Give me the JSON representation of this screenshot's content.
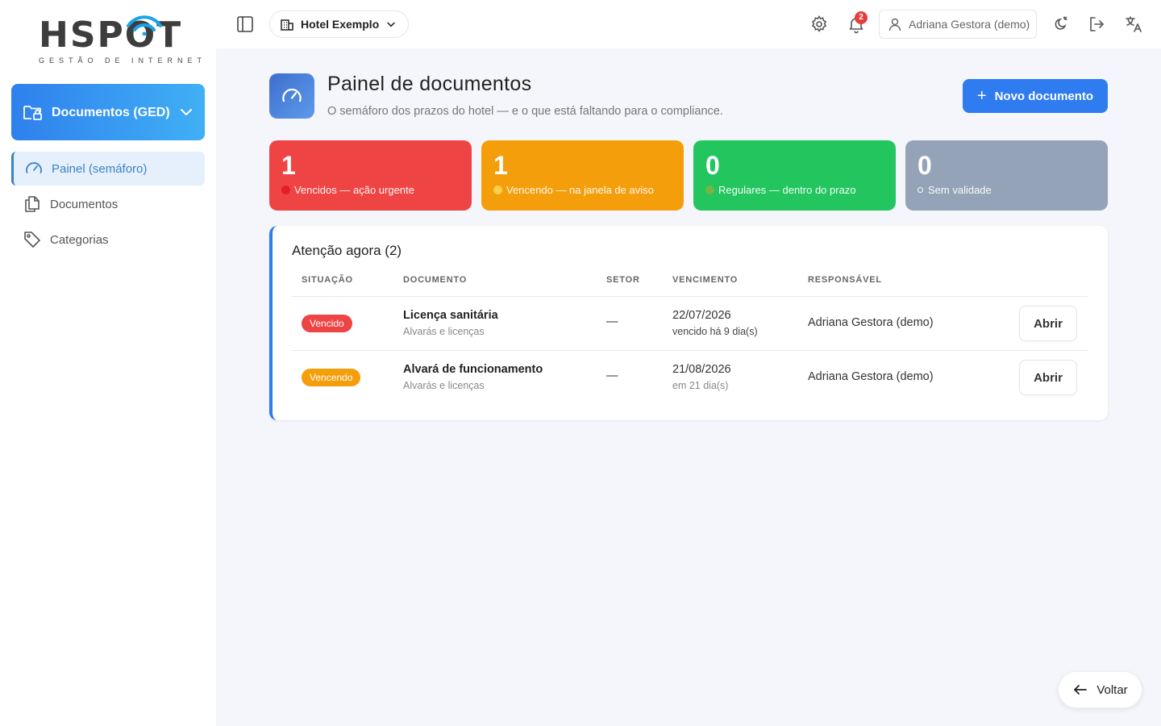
{
  "brand": {
    "name": "HSPOT",
    "tagline": "GESTÃO DE INTERNET"
  },
  "sidebar": {
    "module_label": "Documentos (GED)",
    "items": [
      {
        "label": "Painel (semáforo)",
        "icon": "gauge-icon",
        "active": true
      },
      {
        "label": "Documentos",
        "icon": "documents-icon",
        "active": false
      },
      {
        "label": "Categorias",
        "icon": "tag-icon",
        "active": false
      }
    ]
  },
  "topbar": {
    "hotel": "Hotel Exemplo",
    "notifications_count": "2",
    "user": "Adriana Gestora (demo)"
  },
  "header": {
    "title": "Painel de documentos",
    "subtitle": "O semáforo dos prazos do hotel — e o que está faltando para o compliance.",
    "new_button": "Novo documento"
  },
  "stats": [
    {
      "value": "1",
      "label": "Vencidos — ação urgente",
      "color": "#ef4444"
    },
    {
      "value": "1",
      "label": "Vencendo — na janela de aviso",
      "color": "#f59e0b"
    },
    {
      "value": "0",
      "label": "Regulares — dentro do prazo",
      "color": "#22c55e"
    },
    {
      "value": "0",
      "label": "Sem validade",
      "color": "#94a3b8"
    }
  ],
  "attention": {
    "title": "Atenção agora (2)",
    "columns": [
      "SITUAÇÃO",
      "DOCUMENTO",
      "SETOR",
      "VENCIMENTO",
      "RESPONSÁVEL"
    ],
    "rows": [
      {
        "status": "Vencido",
        "status_color": "#ef4444",
        "document": "Licença sanitária",
        "category": "Alvarás e licenças",
        "sector": "—",
        "due_date": "22/07/2026",
        "due_note": "vencido há 9 dia(s)",
        "responsible": "Adriana Gestora (demo)",
        "action": "Abrir"
      },
      {
        "status": "Vencendo",
        "status_color": "#f59e0b",
        "document": "Alvará de funcionamento",
        "category": "Alvarás e licenças",
        "sector": "—",
        "due_date": "21/08/2026",
        "due_note": "em 21 dia(s)",
        "responsible": "Adriana Gestora (demo)",
        "action": "Abrir"
      }
    ]
  },
  "back_button": "Voltar"
}
